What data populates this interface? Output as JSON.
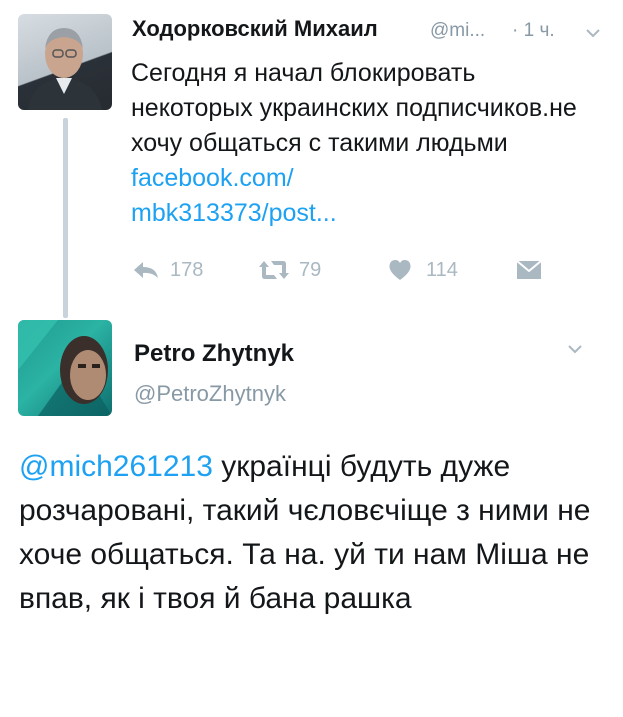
{
  "tweet": {
    "author_name": "Ходорковский Михаил",
    "author_handle": "@mi...",
    "time": "· 1 ч.",
    "text_before_link": "Сегодня я начал блокировать некоторых украинских подписчиков.не хочу общаться с такими людьми ",
    "link_line1": "facebook.com/",
    "link_line2": "mbk313373/post...",
    "actions": {
      "reply_count": "178",
      "retweet_count": "79",
      "like_count": "114"
    }
  },
  "reply": {
    "author_name": "Petro Zhytnyk",
    "author_handle": "@PetroZhytnyk",
    "mention": "@mich261213",
    "text": " українці будуть дуже розчаровані, такий чєловєчіще з ними не хоче общаться. Та на. уй ти нам Міша не впав, як і твоя й бана рашка"
  },
  "colors": {
    "link": "#1da1f2",
    "muted": "#8899a6",
    "action": "#aab8c2",
    "text": "#14171a"
  },
  "icons": [
    "reply-icon",
    "retweet-icon",
    "like-icon",
    "dm-icon",
    "chevron-down-icon"
  ]
}
